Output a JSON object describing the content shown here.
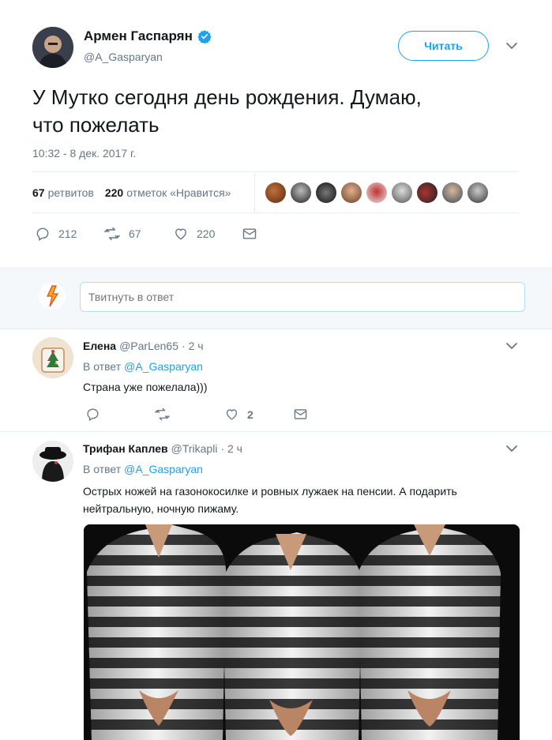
{
  "tweet": {
    "author_name": "Армен Гаспарян",
    "author_handle": "@A_Gasparyan",
    "follow_label": "Читать",
    "text_line1": "У Мутко сегодня день рождения. Думаю,",
    "text_line2": "что пожелать",
    "timestamp": "10:32 - 8 дек. 2017 г.",
    "retweets_count": "67",
    "retweets_label": "ретвитов",
    "likes_count": "220",
    "likes_label": "отметок «Нравится»",
    "actions": {
      "replies": "212",
      "retweets": "67",
      "likes": "220"
    }
  },
  "compose": {
    "placeholder": "Твитнуть в ответ"
  },
  "replies": [
    {
      "name": "Елена",
      "handle": "@ParLen65",
      "time": "· 2 ч",
      "in_reply_prefix": "В ответ",
      "in_reply_to": "@A_Gasparyan",
      "text": "Страна уже пожелала)))",
      "likes": "2"
    },
    {
      "name": "Трифан Каплев",
      "handle": "@Trikapli",
      "time": "· 2 ч",
      "in_reply_prefix": "В ответ",
      "in_reply_to": "@A_Gasparyan",
      "text_line1": "Острых ножей на газонокосилке и ровных лужаек на пенсии. А подарить",
      "text_line2": "нейтральную, ночную пижаму."
    }
  ],
  "colors": {
    "accent": "#1da1f2",
    "muted": "#657786",
    "divider": "#e6ecf0",
    "compose_bg": "#f5f8fa"
  }
}
